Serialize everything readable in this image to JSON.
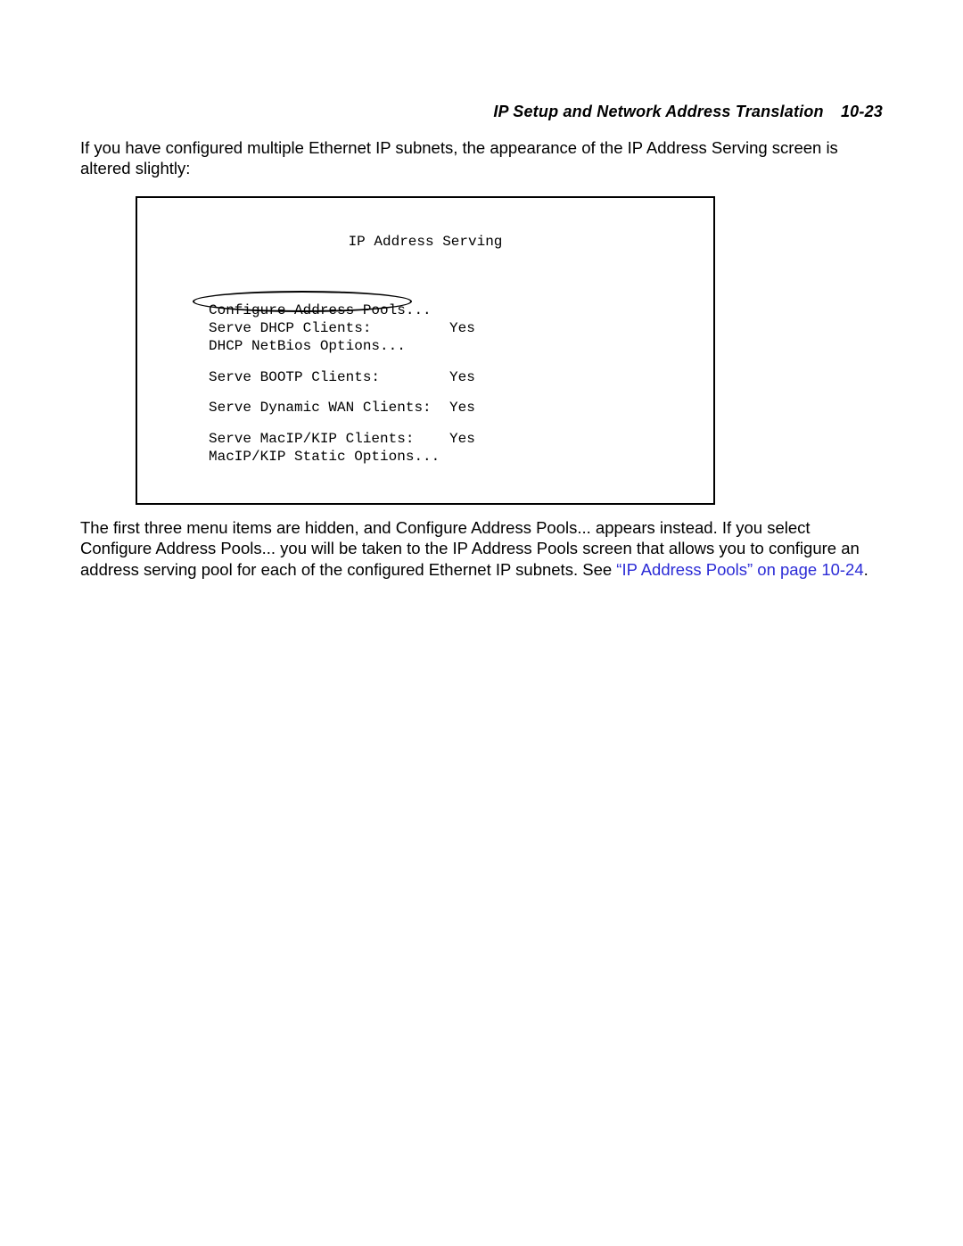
{
  "header": {
    "title": "IP Setup and Network Address Translation",
    "page_number": "10-23"
  },
  "intro_text": "If you have configured multiple Ethernet IP subnets, the appearance of the IP Address Serving screen is altered slightly:",
  "terminal": {
    "title": "IP Address Serving",
    "rows": [
      {
        "label": "Configure Address Pools...",
        "value": ""
      },
      {
        "label": "Serve DHCP Clients:",
        "value": "Yes"
      },
      {
        "label": "DHCP NetBios Options...",
        "value": ""
      },
      {
        "label": "Serve BOOTP Clients:",
        "value": "Yes"
      },
      {
        "label": "Serve Dynamic WAN Clients:",
        "value": "Yes"
      },
      {
        "label": "Serve MacIP/KIP Clients:",
        "value": "Yes"
      },
      {
        "label": "MacIP/KIP Static Options...",
        "value": ""
      }
    ]
  },
  "after": {
    "text_before_link": "The first three menu items are hidden, and Configure Address Pools... appears instead. If you select Configure Address Pools... you will be taken to the IP Address Pools screen that allows you to configure an address serving pool for each of the configured Ethernet IP subnets. See ",
    "link_text": "“IP Address Pools” on page 10-24",
    "text_after_link": "."
  }
}
